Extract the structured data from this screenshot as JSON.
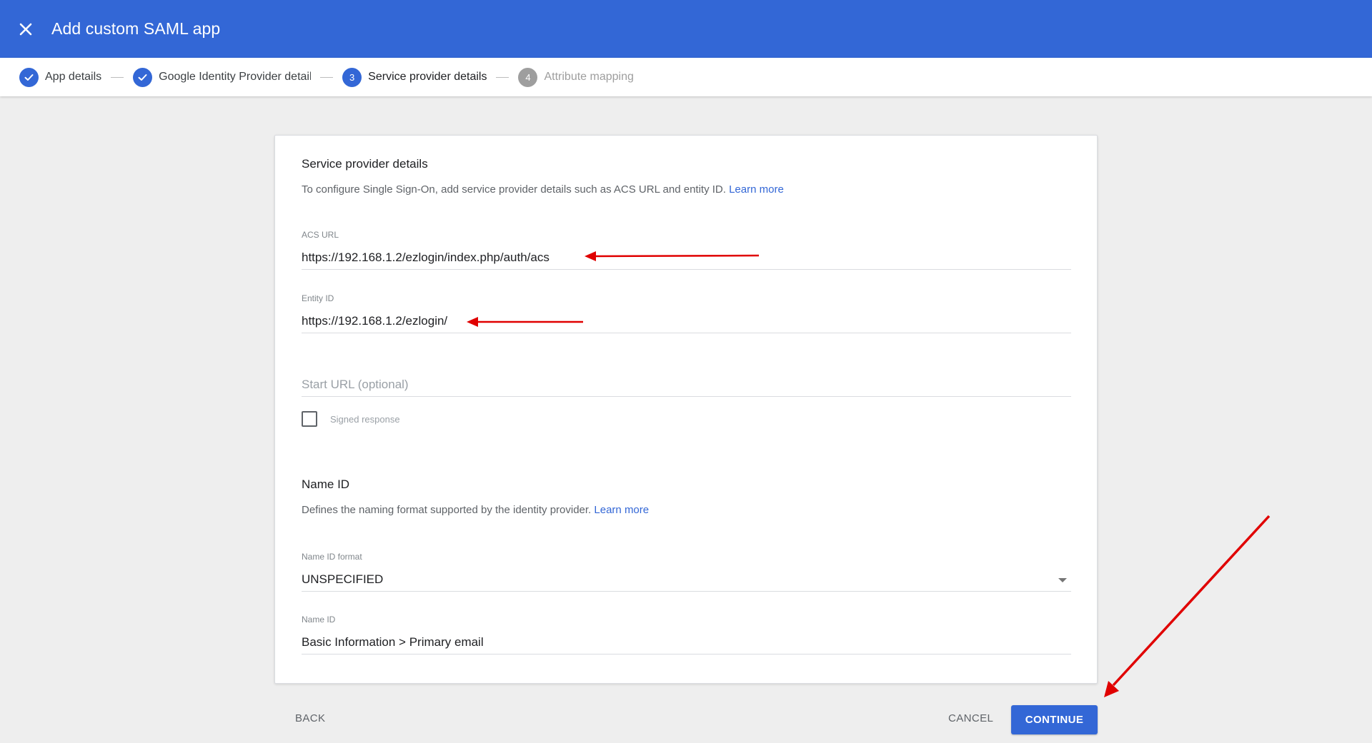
{
  "header": {
    "title": "Add custom SAML app",
    "background": "#3367d6",
    "close_icon": "close-icon"
  },
  "stepper": {
    "steps": [
      {
        "number": "1",
        "label": "App details",
        "state": "done"
      },
      {
        "number": "2",
        "label": "Google Identity Provider details",
        "state": "done"
      },
      {
        "number": "3",
        "label": "Service provider details",
        "state": "active"
      },
      {
        "number": "4",
        "label": "Attribute mapping",
        "state": "pending"
      }
    ]
  },
  "service_provider": {
    "title": "Service provider details",
    "description": "To configure Single Sign-On, add service provider details such as ACS URL and entity ID.",
    "learn_more": "Learn more",
    "acs_url": {
      "label": "ACS URL",
      "value": "https://192.168.1.2/ezlogin/index.php/auth/acs"
    },
    "entity_id": {
      "label": "Entity ID",
      "value": "https://192.168.1.2/ezlogin/"
    },
    "start_url": {
      "placeholder": "Start URL (optional)",
      "value": ""
    },
    "signed_response": {
      "label": "Signed response",
      "checked": false
    }
  },
  "name_id": {
    "title": "Name ID",
    "description": "Defines the naming format supported by the identity provider.",
    "learn_more": "Learn more",
    "format": {
      "label": "Name ID format",
      "value": "UNSPECIFIED"
    },
    "name_id_field": {
      "label": "Name ID",
      "value": "Basic Information > Primary email"
    }
  },
  "footer": {
    "back": "BACK",
    "cancel": "CANCEL",
    "continue": "CONTINUE"
  },
  "colors": {
    "accent": "#3367d6",
    "annotation": "#e00000"
  }
}
